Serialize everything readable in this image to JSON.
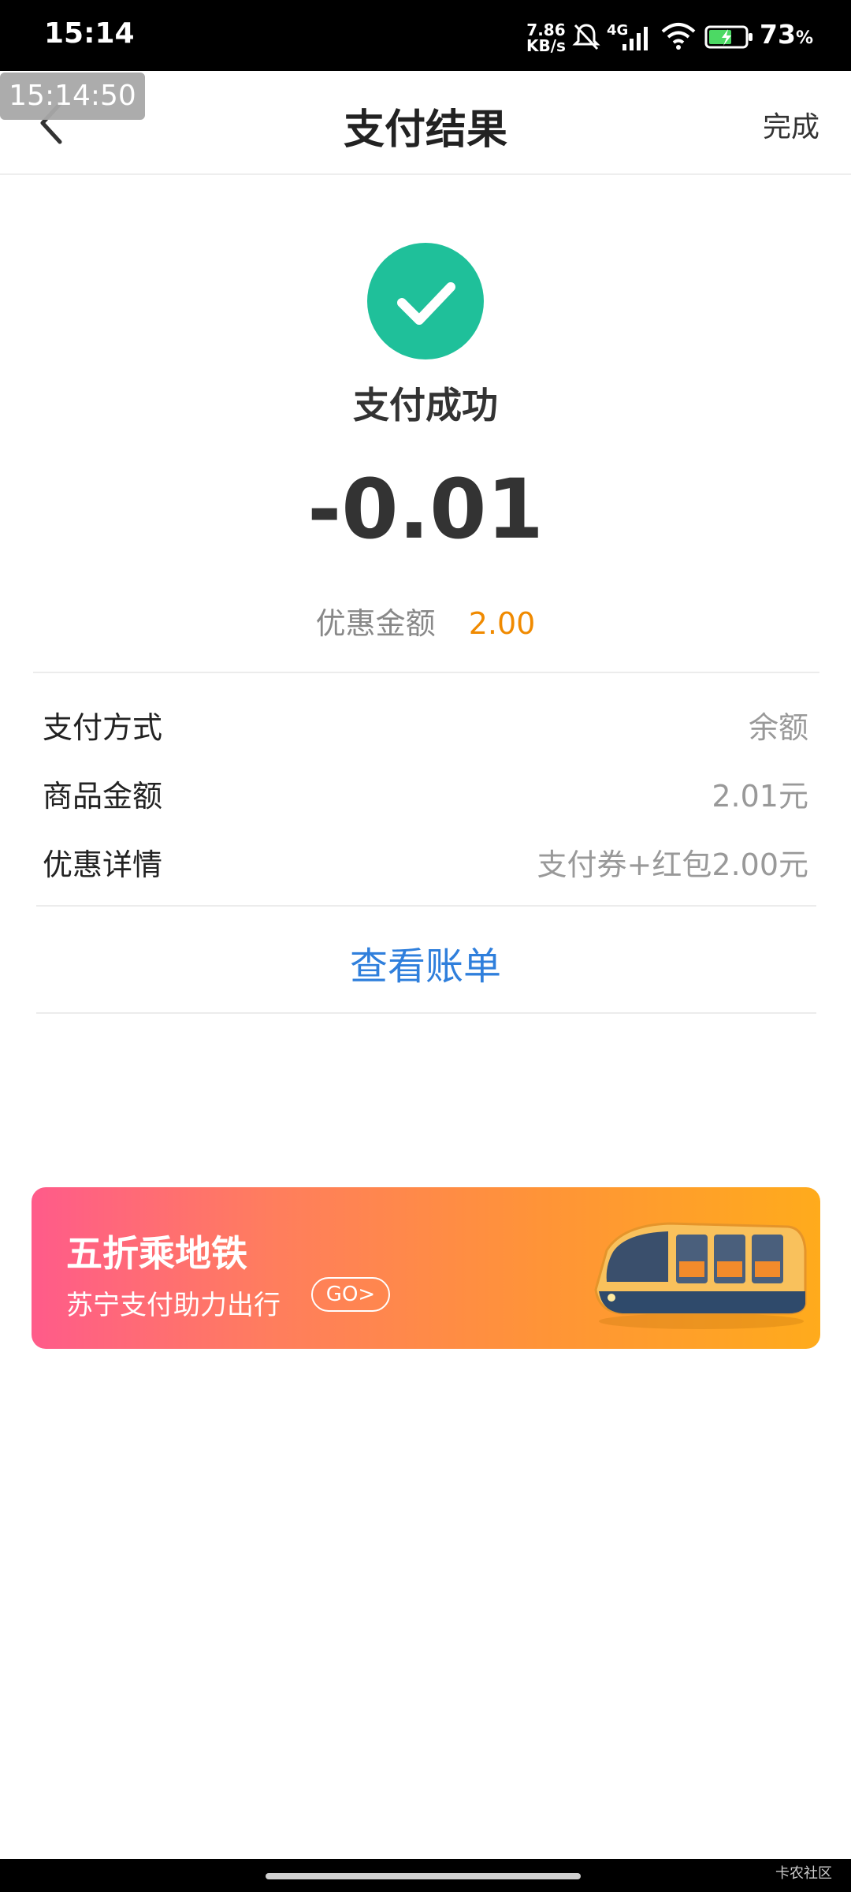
{
  "status_bar": {
    "time": "15:14",
    "speed_value": "7.86",
    "speed_unit": "KB/s",
    "network": "4G",
    "battery_percent": "73",
    "battery_suffix": "%"
  },
  "overlay_timestamp": "15:14:50",
  "header": {
    "title": "支付结果",
    "done_label": "完成"
  },
  "result": {
    "status_text": "支付成功",
    "amount": "-0.01",
    "discount_label": "优惠金额",
    "discount_value": "2.00"
  },
  "details": [
    {
      "label": "支付方式",
      "value": "余额"
    },
    {
      "label": "商品金额",
      "value": "2.01元"
    },
    {
      "label": "优惠详情",
      "value": "支付券+红包2.00元"
    }
  ],
  "view_bill_label": "查看账单",
  "banner": {
    "title": "五折乘地铁",
    "subtitle": "苏宁支付助力出行",
    "go_label": "GO>"
  },
  "watermark": "卡农社区",
  "colors": {
    "success_green": "#1fc09a",
    "discount_orange": "#f08a00",
    "link_blue": "#2f7fdc"
  },
  "icons": {
    "back": "chevron-left-icon",
    "success": "checkmark-circle-icon",
    "banner_image": "subway-train-icon"
  }
}
